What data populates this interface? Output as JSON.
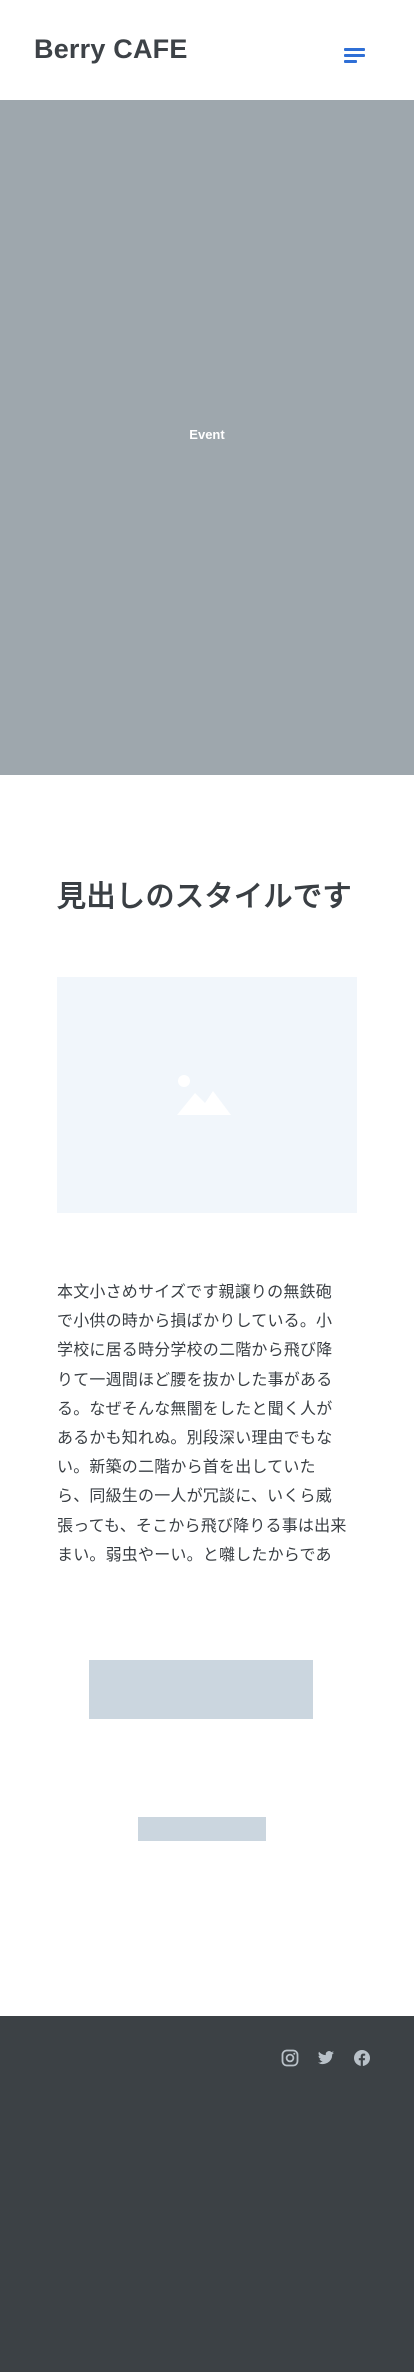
{
  "header": {
    "brand": "Berry CAFE",
    "menu_icon": "hamburger-menu-icon",
    "accent_color": "#2f6fd6"
  },
  "hero": {
    "label": "Event",
    "background_color": "#9ea7ad"
  },
  "content": {
    "heading": "見出しのスタイルです",
    "image_icon": "image-placeholder-icon",
    "body_lines": [
      "本文小さめサイズです親譲りの無鉄砲",
      "で小供の時から損ばかりしている。小",
      "学校に居る時分学校の二階から飛び降",
      "りて一週間ほど腰を抜かした事がある",
      "る。なぜそんな無闇をしたと聞く人が",
      "あるかも知れぬ。別段深い理由でもな",
      "い。新築の二階から首を出していた",
      "ら、同級生の一人が冗談に、いくら威",
      "張っても、そこから飛び降りる事は出来",
      "まい。弱虫やーい。と囃したからであ"
    ]
  },
  "footer": {
    "background_color": "#3c4145",
    "social_icons": [
      "instagram-icon",
      "twitter-icon",
      "facebook-icon"
    ]
  }
}
